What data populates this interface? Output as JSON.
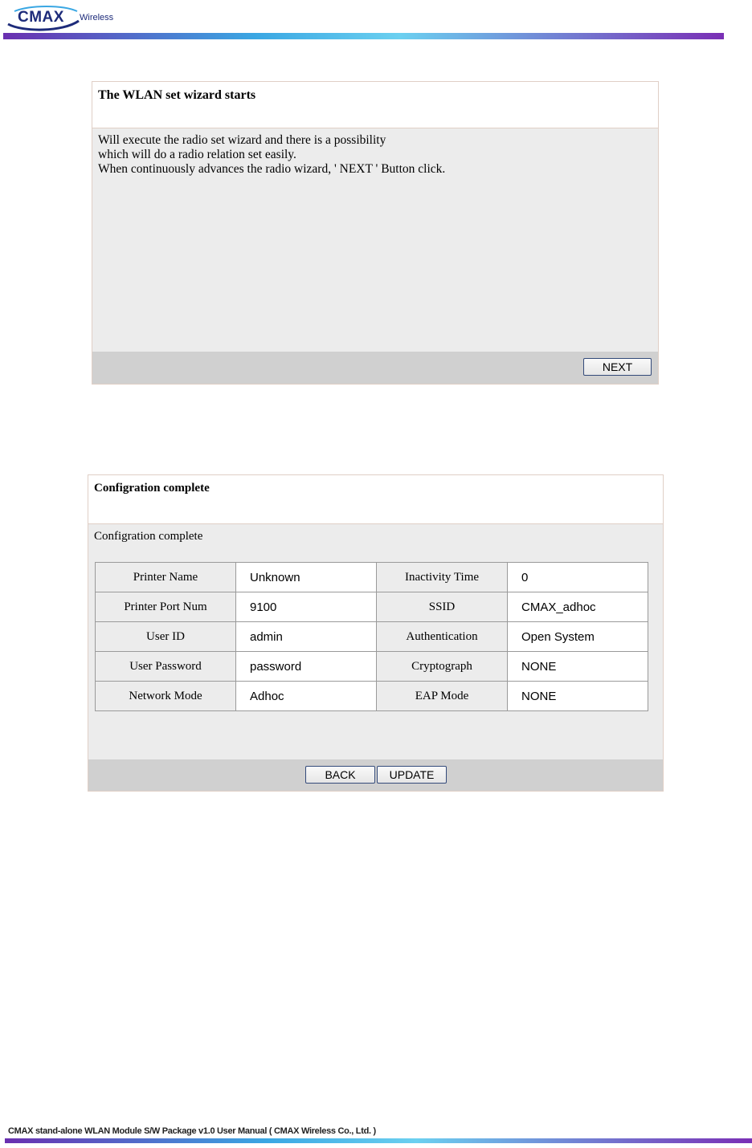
{
  "header": {
    "logo_main": "CMAX",
    "logo_sub": "Wireless"
  },
  "wizard": {
    "title": "The WLAN set wizard starts",
    "lines": [
      "Will execute the radio set wizard and there is a possibility",
      "which will do a radio relation set easily.",
      "When continuously advances the radio wizard, ' NEXT ' Button click."
    ],
    "next_label": "NEXT"
  },
  "config": {
    "title": "Configration complete",
    "subtitle": "Configration complete",
    "rows": [
      {
        "label1": "Printer Name",
        "value1": "Unknown",
        "label2": "Inactivity Time",
        "value2": "0"
      },
      {
        "label1": "Printer Port Num",
        "value1": "9100",
        "label2": "SSID",
        "value2": "CMAX_adhoc"
      },
      {
        "label1": "User ID",
        "value1": "admin",
        "label2": "Authentication",
        "value2": "Open System"
      },
      {
        "label1": "User Password",
        "value1": "password",
        "label2": "Cryptograph",
        "value2": "NONE"
      },
      {
        "label1": "Network Mode",
        "value1": "Adhoc",
        "label2": "EAP Mode",
        "value2": "NONE"
      }
    ],
    "back_label": "BACK",
    "update_label": "UPDATE"
  },
  "footer": {
    "text": "CMAX stand-alone WLAN Module S/W Package v1.0 User Manual ( CMAX Wireless Co., Ltd. )"
  }
}
